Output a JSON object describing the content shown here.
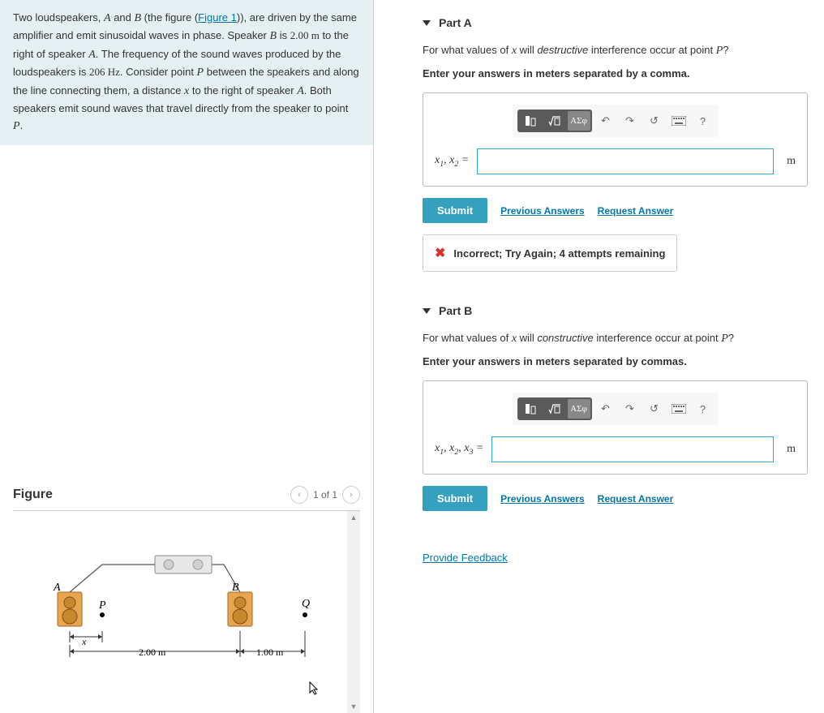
{
  "problem": {
    "text_prefix": "Two loudspeakers, ",
    "varA": "A",
    "and": " and ",
    "varB": "B",
    "text_fig": " (the figure (",
    "fig_link": "Figure 1",
    "text_after_fig": ")), are driven by the same amplifier and emit sinusoidal waves in phase. Speaker ",
    "text_is": " is ",
    "dist1": "2.00 m",
    "text_right": " to the right of speaker ",
    "text_freq": ". The frequency of the sound waves produced by the loudspeakers is ",
    "freq": "206 Hz",
    "text_consider": ". Consider point ",
    "varP": "P",
    "text_between": " between the speakers and along the line connecting them, a distance ",
    "varx": "x",
    "text_toright": " to the right of speaker ",
    "text_both": ". Both speakers emit sound waves that travel directly from the speaker to point ",
    "period": "."
  },
  "figure": {
    "title": "Figure",
    "counter": "1 of 1",
    "labelA": "A",
    "labelB": "B",
    "labelP": "P",
    "labelQ": "Q",
    "labelx": "x",
    "dist_ab": "2.00 m",
    "dist_bq": "1.00 m"
  },
  "partA": {
    "title": "Part A",
    "question_pre": "For what values of ",
    "question_var": "x",
    "question_mid": " will ",
    "question_type": "destructive",
    "question_post": " interference occur at point ",
    "question_P": "P",
    "question_end": "?",
    "instruction": "Enter your answers in meters separated by a comma.",
    "vars_label": "x₁, x₂ =",
    "unit": "m",
    "submit": "Submit",
    "prev_answers": "Previous Answers",
    "request_answer": "Request Answer",
    "feedback": "Incorrect; Try Again; 4 attempts remaining"
  },
  "partB": {
    "title": "Part B",
    "question_pre": "For what values of ",
    "question_var": "x",
    "question_mid": " will ",
    "question_type": "constructive",
    "question_post": " interference occur at point ",
    "question_P": "P",
    "question_end": "?",
    "instruction": "Enter your answers in meters separated by commas.",
    "vars_label": "x₁, x₂, x₃ =",
    "unit": "m",
    "submit": "Submit",
    "prev_answers": "Previous Answers",
    "request_answer": "Request Answer"
  },
  "toolbar": {
    "greek": "ΑΣφ",
    "help": "?"
  },
  "provide_feedback": "Provide Feedback"
}
